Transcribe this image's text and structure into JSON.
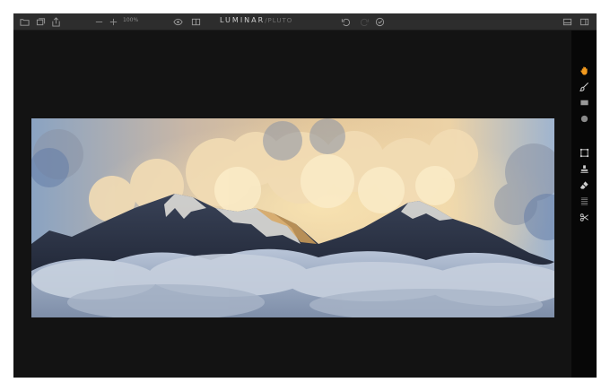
{
  "app": {
    "title_main": "LUMINAR",
    "title_sub": "/PLUTO"
  },
  "toolbar": {
    "zoom_level": "100%",
    "left_icons": [
      "folder-open-icon",
      "batch-icon",
      "export-icon"
    ],
    "zoom_icons": [
      "zoom-out-icon",
      "zoom-in-icon"
    ],
    "view_icons": [
      "eye-icon",
      "compare-icon"
    ],
    "history_icons": [
      "undo-icon",
      "redo-icon",
      "history-icon"
    ],
    "right_icons": [
      "presets-panel-icon",
      "sidebar-toggle-icon"
    ]
  },
  "sidebar": {
    "tools": [
      {
        "name": "hand-tool-icon",
        "color": "#f29a1e"
      },
      {
        "name": "brush-tool-icon"
      },
      {
        "name": "gradient-tool-icon"
      },
      {
        "name": "radial-mask-icon"
      },
      {
        "name": "crop-tool-icon"
      },
      {
        "name": "clone-stamp-icon"
      },
      {
        "name": "erase-tool-icon"
      },
      {
        "name": "noise-tool-icon"
      },
      {
        "name": "cut-tool-icon"
      }
    ]
  },
  "image": {
    "subject": "mountain peaks above clouds at sunset"
  },
  "colors": {
    "toolbar_bg": "#2d2d2d",
    "canvas_bg": "#131313",
    "sidebar_bg": "#070707",
    "accent": "#f29a1e"
  }
}
